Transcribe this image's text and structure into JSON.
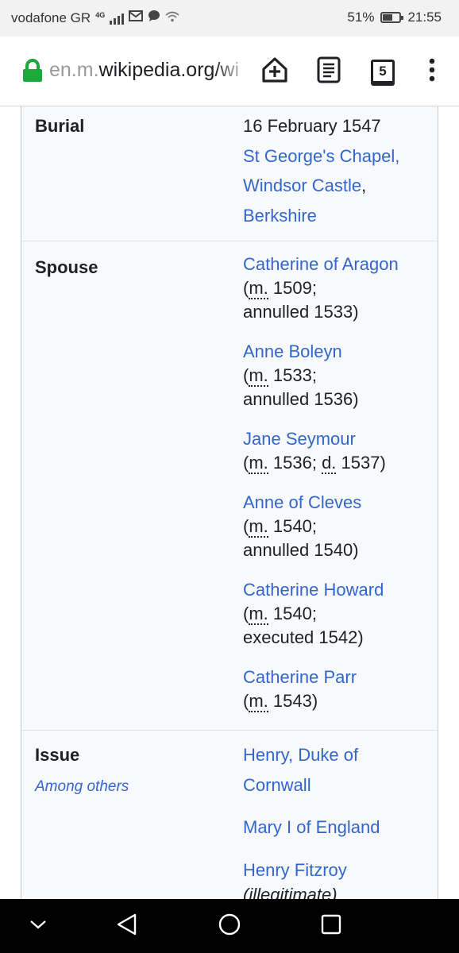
{
  "status_bar": {
    "carrier": "vodafone GR",
    "network": "4G",
    "battery_percent": "51%",
    "battery_level": 0.51,
    "time": "21:55"
  },
  "browser": {
    "url_prefix": "en.m.",
    "url_main": "wikipedia.org/wi",
    "tab_count": "5",
    "icons": [
      "lock-icon",
      "add-to-home-icon",
      "reader-mode-icon",
      "tab-switcher-icon",
      "menu-kebab-icon"
    ]
  },
  "infobox": {
    "burial": {
      "label": "Burial",
      "date": "16 February 1547",
      "place_link1": "St George's Chapel,",
      "place_link2": "Windsor Castle",
      "place_sep": ",",
      "place_link3": "Berkshire"
    },
    "spouse": {
      "label": "Spouse",
      "m": "m.",
      "d": "d.",
      "entries": [
        {
          "name": "Catherine of Aragon",
          "line2": " 1509;",
          "line3": "annulled 1533)"
        },
        {
          "name": "Anne Boleyn",
          "line2": " 1533;",
          "line3": "annulled 1536)"
        },
        {
          "name": "Jane Seymour",
          "line2a": " 1536; ",
          "line2b": " 1537)"
        },
        {
          "name": "Anne of Cleves",
          "line2": " 1540;",
          "line3": "annulled 1540)"
        },
        {
          "name": "Catherine Howard",
          "line2": " 1540;",
          "line3": "executed 1542)"
        },
        {
          "name": "Catherine Parr",
          "line2": " 1543)"
        }
      ]
    },
    "issue": {
      "label": "Issue",
      "sublabel": "Among others",
      "entries": [
        {
          "name_l1": "Henry, Duke of",
          "name_l2": "Cornwall"
        },
        {
          "name": "Mary I of England"
        },
        {
          "name": "Henry Fitzroy",
          "note": "(illegitimate)"
        }
      ]
    }
  },
  "nav_bar": {
    "icons": [
      "hide-nav-chevron-icon",
      "back-triangle-icon",
      "home-circle-icon",
      "recents-square-icon"
    ]
  }
}
